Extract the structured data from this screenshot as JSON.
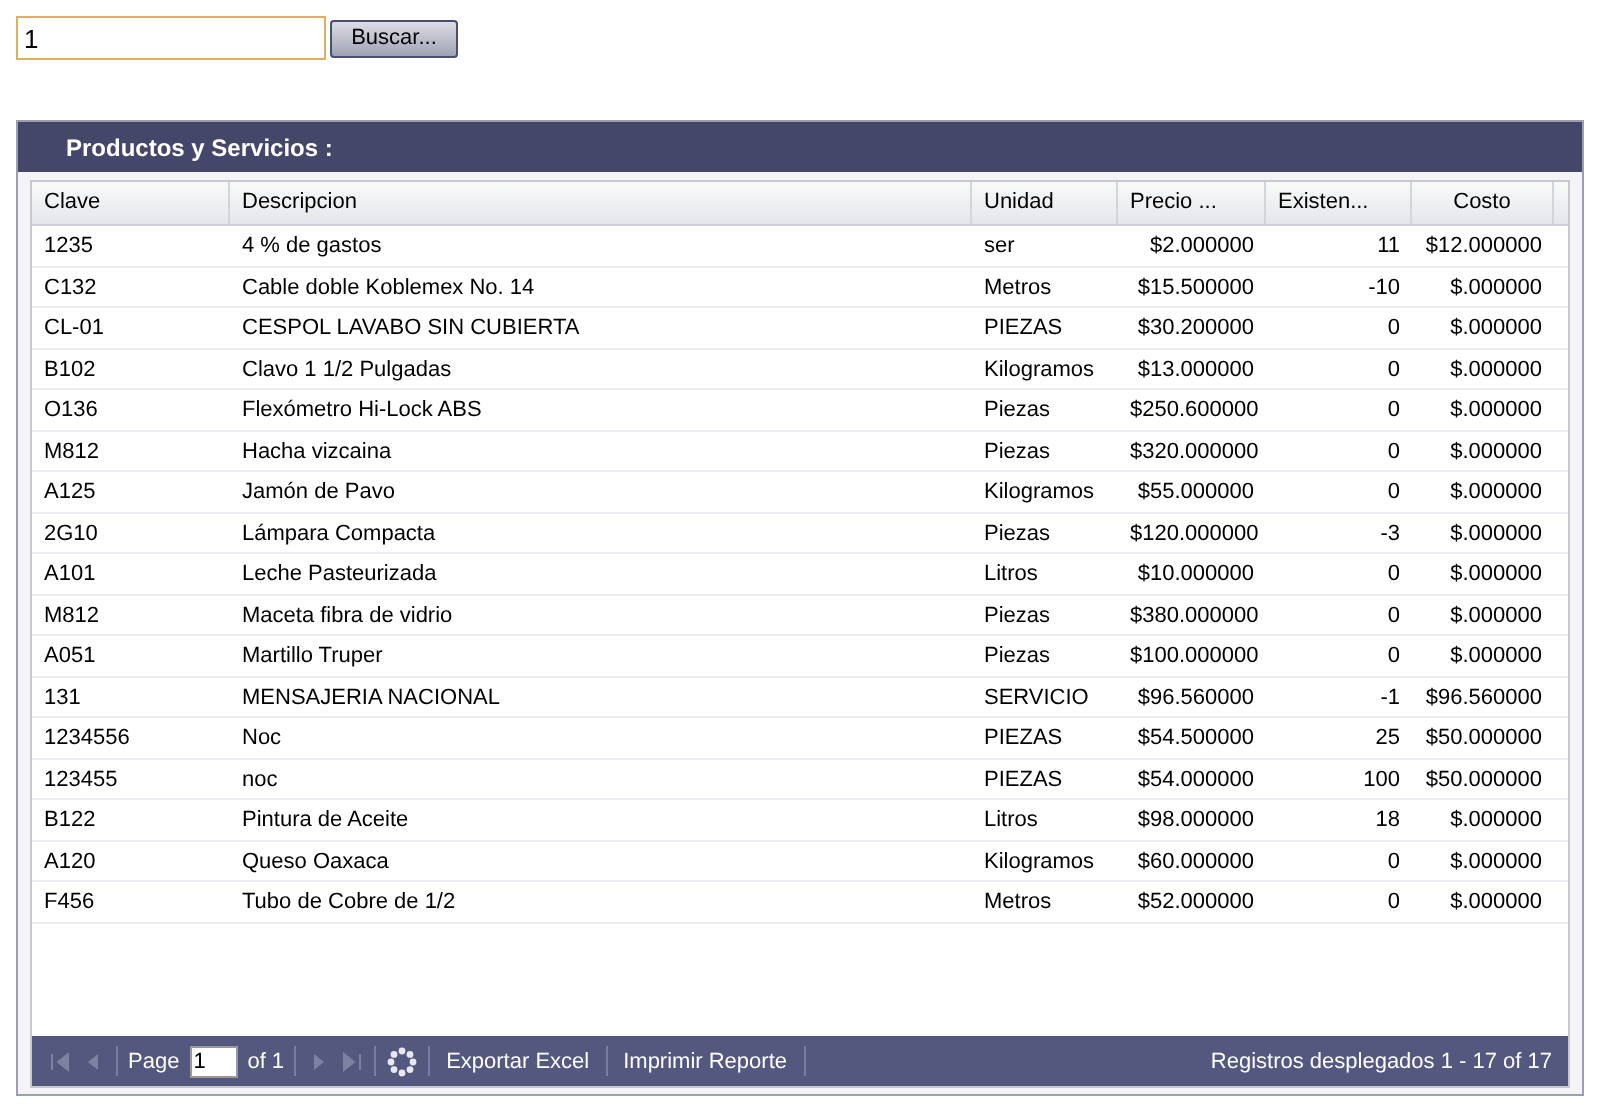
{
  "search": {
    "value": "1",
    "button": "Buscar..."
  },
  "panel": {
    "title": "Productos y Servicios :"
  },
  "table": {
    "columns": [
      "Clave",
      "Descripcion",
      "Unidad",
      "Precio ...",
      "Existen...",
      "Costo"
    ],
    "rows": [
      [
        "1235",
        "4 % de gastos",
        "ser",
        "$2.000000",
        "11",
        "$12.000000"
      ],
      [
        "C132",
        "Cable doble Koblemex No. 14",
        "Metros",
        "$15.500000",
        "-10",
        "$.000000"
      ],
      [
        "CL-01",
        "CESPOL LAVABO SIN CUBIERTA",
        "PIEZAS",
        "$30.200000",
        "0",
        "$.000000"
      ],
      [
        "B102",
        "Clavo 1 1/2 Pulgadas",
        "Kilogramos",
        "$13.000000",
        "0",
        "$.000000"
      ],
      [
        "O136",
        "Flexómetro Hi-Lock ABS",
        "Piezas",
        "$250.600000",
        "0",
        "$.000000"
      ],
      [
        "M812",
        "Hacha vizcaina",
        "Piezas",
        "$320.000000",
        "0",
        "$.000000"
      ],
      [
        "A125",
        "Jamón de Pavo",
        "Kilogramos",
        "$55.000000",
        "0",
        "$.000000"
      ],
      [
        "2G10",
        "Lámpara Compacta",
        "Piezas",
        "$120.000000",
        "-3",
        "$.000000"
      ],
      [
        "A101",
        "Leche Pasteurizada",
        "Litros",
        "$10.000000",
        "0",
        "$.000000"
      ],
      [
        "M812",
        "Maceta fibra de vidrio",
        "Piezas",
        "$380.000000",
        "0",
        "$.000000"
      ],
      [
        "A051",
        "Martillo Truper",
        "Piezas",
        "$100.000000",
        "0",
        "$.000000"
      ],
      [
        "131",
        "MENSAJERIA NACIONAL",
        "SERVICIO",
        "$96.560000",
        "-1",
        "$96.560000"
      ],
      [
        "1234556",
        "Noc",
        "PIEZAS",
        "$54.500000",
        "25",
        "$50.000000"
      ],
      [
        "123455",
        "noc",
        "PIEZAS",
        "$54.000000",
        "100",
        "$50.000000"
      ],
      [
        "B122",
        "Pintura de Aceite",
        "Litros",
        "$98.000000",
        "18",
        "$.000000"
      ],
      [
        "A120",
        "Queso Oaxaca",
        "Kilogramos",
        "$60.000000",
        "0",
        "$.000000"
      ],
      [
        "F456",
        "Tubo de Cobre de 1/2",
        "Metros",
        "$52.000000",
        "0",
        "$.000000"
      ]
    ]
  },
  "pager": {
    "first_disabled": true,
    "prev_disabled": true,
    "page_label": "Page",
    "page": "1",
    "of": "of 1",
    "next_disabled": true,
    "last_disabled": true,
    "buttons": [
      "Exportar Excel",
      "Imprimir Reporte"
    ],
    "info": "Registros desplegados 1 - 17 of 17"
  }
}
